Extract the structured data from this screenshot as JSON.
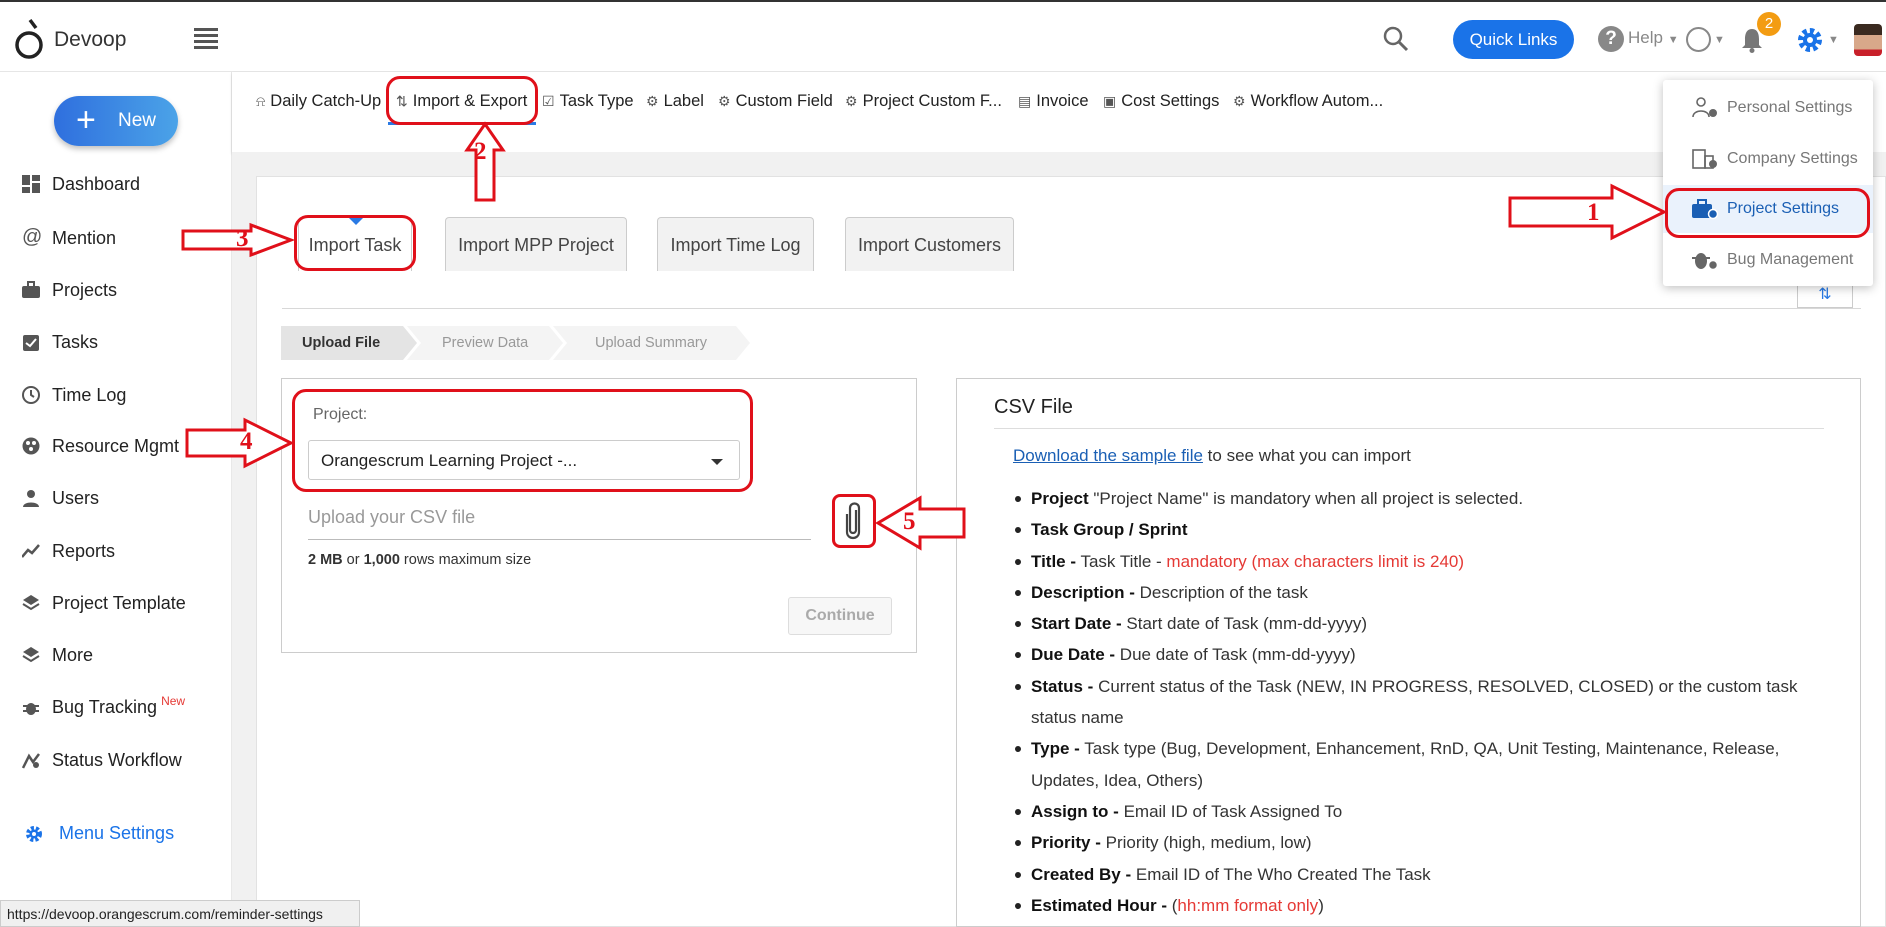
{
  "header": {
    "brand": "Devoop",
    "quick_links": "Quick Links",
    "help_label": "Help",
    "notification_count": "2"
  },
  "sidebar": {
    "new_button": "New",
    "items": [
      {
        "label": "Dashboard",
        "icon": "dashboard-icon"
      },
      {
        "label": "Mention",
        "icon": "at-icon"
      },
      {
        "label": "Projects",
        "icon": "briefcase-icon"
      },
      {
        "label": "Tasks",
        "icon": "task-check-icon"
      },
      {
        "label": "Time Log",
        "icon": "clock-icon"
      },
      {
        "label": "Resource Mgmt",
        "icon": "resource-icon"
      },
      {
        "label": "Users",
        "icon": "user-icon"
      },
      {
        "label": "Reports",
        "icon": "chart-line-icon"
      },
      {
        "label": "Project Template",
        "icon": "layers-icon"
      },
      {
        "label": "More",
        "icon": "layers-icon"
      },
      {
        "label": "Bug Tracking",
        "icon": "bug-icon",
        "badge": "New"
      },
      {
        "label": "Status Workflow",
        "icon": "workflow-icon"
      }
    ],
    "menu_settings": "Menu Settings"
  },
  "subnav": {
    "items": [
      "Daily Catch-Up",
      "Import & Export",
      "Task Type",
      "Label",
      "Custom Field",
      "Project Custom F...",
      "Invoice",
      "Cost Settings",
      "Workflow Autom..."
    ]
  },
  "settings_menu": {
    "items": [
      "Personal Settings",
      "Company Settings",
      "Project Settings",
      "Bug Management"
    ],
    "selected": "Project Settings"
  },
  "import_tabs": [
    "Import Task",
    "Import MPP Project",
    "Import Time Log",
    "Import Customers"
  ],
  "steps": [
    "Upload File",
    "Preview Data",
    "Upload Summary"
  ],
  "upload_form": {
    "project_label": "Project:",
    "project_value": "Orangescrum Learning Project -...",
    "upload_placeholder": "Upload your CSV file",
    "limit_size": "2 MB",
    "limit_or": " or ",
    "limit_rows": "1,000",
    "limit_suffix": " rows maximum size",
    "continue_button": "Continue"
  },
  "csv_info": {
    "title": "CSV File",
    "download_link": "Download the sample file",
    "download_suffix": " to see what you can import",
    "fields": [
      {
        "name": "Project",
        "desc": " \"Project Name\" is mandatory when all project is selected."
      },
      {
        "name": "Task Group / Sprint",
        "desc": ""
      },
      {
        "name": "Title -",
        "desc": " Task Title - ",
        "red": "mandatory (max characters limit is 240)"
      },
      {
        "name": "Description -",
        "desc": " Description of the task"
      },
      {
        "name": "Start Date -",
        "desc": " Start date of Task (mm-dd-yyyy)"
      },
      {
        "name": "Due Date -",
        "desc": " Due date of Task (mm-dd-yyyy)"
      },
      {
        "name": "Status -",
        "desc": " Current status of the Task (NEW, IN PROGRESS, RESOLVED, CLOSED) or the custom task status name"
      },
      {
        "name": "Type -",
        "desc": " Task type (Bug, Development, Enhancement, RnD, QA, Unit Testing, Maintenance, Release, Updates, Idea, Others)"
      },
      {
        "name": "Assign to -",
        "desc": " Email ID of Task Assigned To"
      },
      {
        "name": "Priority -",
        "desc": " Priority (high, medium, low)"
      },
      {
        "name": "Created By -",
        "desc": " Email ID of The Who Created The Task"
      },
      {
        "name": "Estimated Hour -",
        "desc": " (",
        "red": "hh:mm format only",
        "tail": ")"
      }
    ]
  },
  "status_bar": "https://devoop.orangescrum.com/reminder-settings",
  "annotations": [
    "1",
    "2",
    "3",
    "4",
    "5"
  ],
  "colors": {
    "accent": "#1a73e8",
    "annotation": "#e0101a",
    "badge": "#f39c12"
  }
}
